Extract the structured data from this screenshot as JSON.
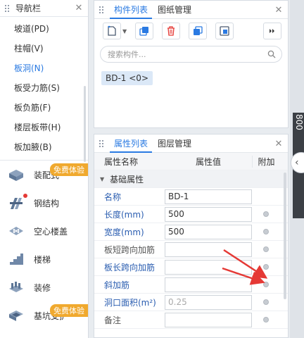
{
  "nav": {
    "title": "导航栏",
    "items": [
      {
        "label": "坡道(PD)",
        "active": false
      },
      {
        "label": "柱帽(V)",
        "active": false
      },
      {
        "label": "板洞(N)",
        "active": true
      },
      {
        "label": "板受力筋(S)",
        "active": false
      },
      {
        "label": "板负筋(F)",
        "active": false
      },
      {
        "label": "楼层板带(H)",
        "active": false
      },
      {
        "label": "板加腋(B)",
        "active": false
      }
    ],
    "categories": [
      {
        "label": "装配式",
        "icon": "prefab-icon",
        "badge": "免费体验"
      },
      {
        "label": "钢结构",
        "icon": "steel-structure-icon",
        "dot": true
      },
      {
        "label": "空心楼盖",
        "icon": "hollow-floor-icon"
      },
      {
        "label": "楼梯",
        "icon": "stairs-icon"
      },
      {
        "label": "装修",
        "icon": "decoration-icon"
      },
      {
        "label": "基坑支护",
        "icon": "foundation-pit-icon",
        "badge": "免费体验"
      }
    ]
  },
  "components": {
    "tabs": [
      "构件列表",
      "图纸管理"
    ],
    "active_tab": 0,
    "toolbar": [
      "new-icon",
      "copy-icon",
      "delete-icon",
      "duplicate-icon",
      "export-icon",
      "more-icon"
    ],
    "search_placeholder": "搜索构件...",
    "items": [
      "BD-1 <0>"
    ]
  },
  "properties": {
    "tabs": [
      "属性列表",
      "图层管理"
    ],
    "active_tab": 0,
    "headers": {
      "name": "属性名称",
      "value": "属性值",
      "extra": "附加"
    },
    "group": "基础属性",
    "rows": [
      {
        "name": "名称",
        "value": "BD-1",
        "checkbox": false,
        "disabled": false,
        "blue": true
      },
      {
        "name": "长度(mm)",
        "value": "500",
        "checkbox": true,
        "disabled": false,
        "blue": true
      },
      {
        "name": "宽度(mm)",
        "value": "500",
        "checkbox": true,
        "disabled": false,
        "blue": true
      },
      {
        "name": "板短跨向加筋",
        "value": "",
        "checkbox": true,
        "disabled": false,
        "blue": false
      },
      {
        "name": "板长跨向加筋",
        "value": "",
        "checkbox": true,
        "disabled": false,
        "blue": true
      },
      {
        "name": "斜加筋",
        "value": "",
        "checkbox": true,
        "disabled": false,
        "blue": true
      },
      {
        "name": "洞口面积(m²)",
        "value": "0.25",
        "checkbox": true,
        "disabled": true,
        "blue": true
      },
      {
        "name": "备注",
        "value": "",
        "checkbox": true,
        "disabled": false,
        "blue": false
      }
    ]
  },
  "right_edge": {
    "label": "800"
  },
  "colors": {
    "accent": "#2a7ae2",
    "badge": "#f0a92e",
    "annotation_arrow": "#e53935"
  }
}
